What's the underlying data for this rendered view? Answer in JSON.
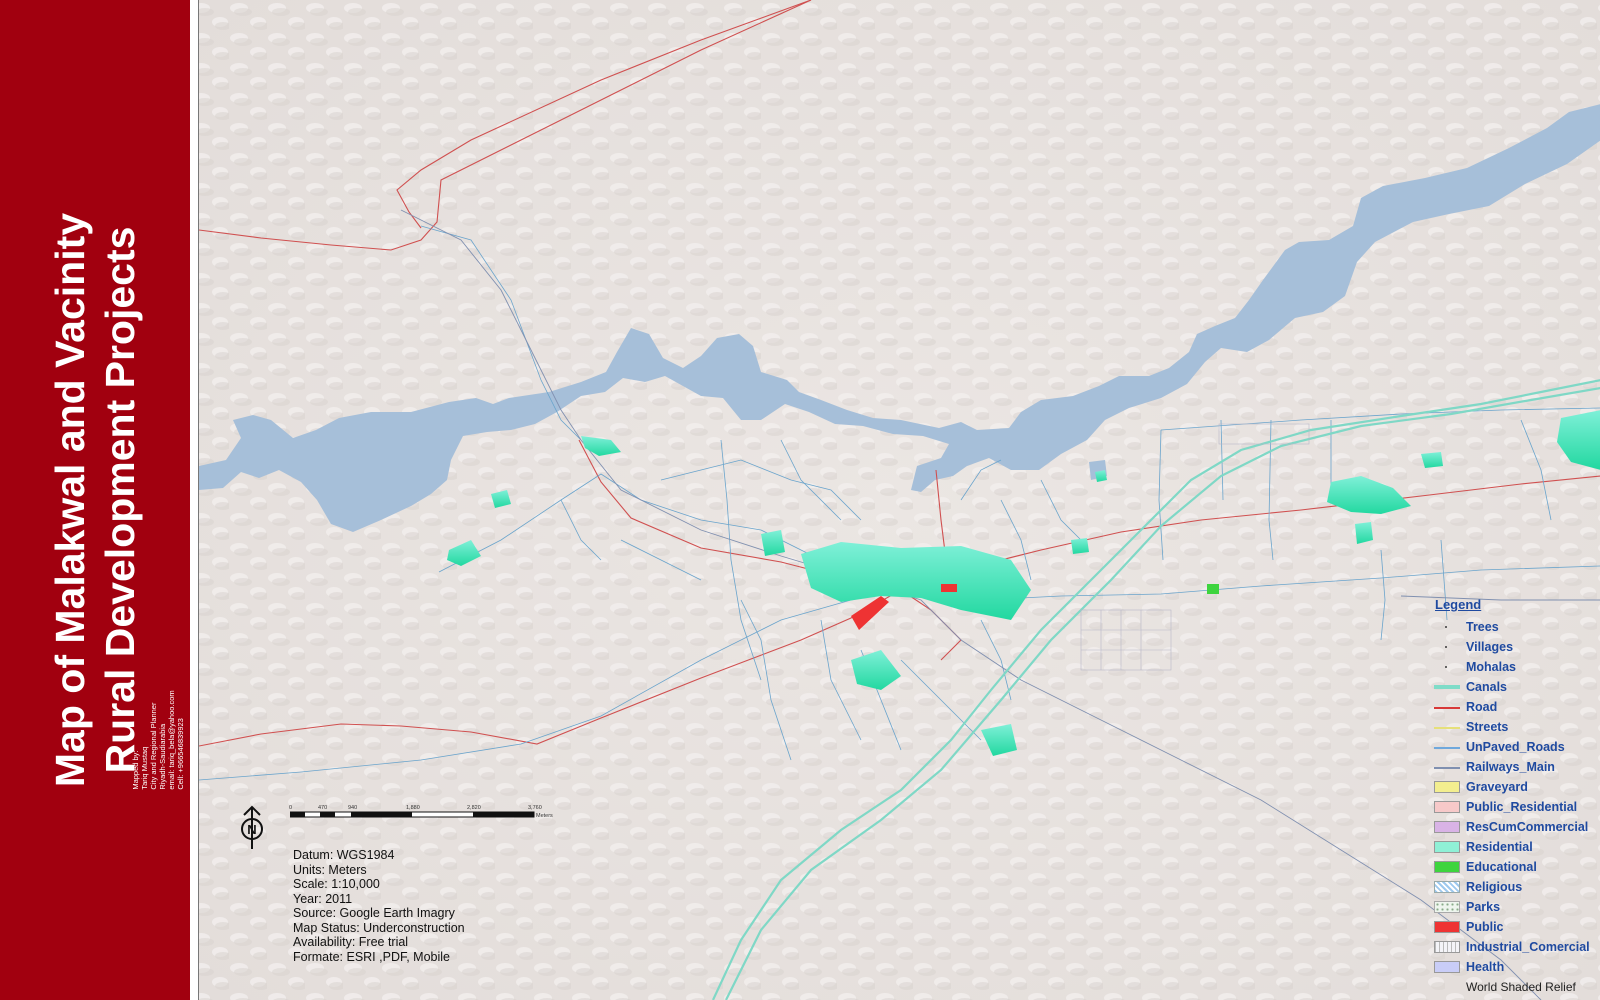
{
  "title": {
    "line1": "Map of Malakwal and Vacinity",
    "line2": "Rural Development Projects"
  },
  "mapper": [
    "Mapped by:",
    "Tariq Mustaq",
    "City and Regional Planner",
    "Riyadh-Saudiarabia",
    "email: tariq_bela@yahoo.com",
    "Cell: +966546839923"
  ],
  "legend": {
    "title": "Legend",
    "items": [
      {
        "label": "Trees",
        "icon": "dot",
        "color": "#3a3a3a"
      },
      {
        "label": "Villages",
        "icon": "dot",
        "color": "#3a3a3a"
      },
      {
        "label": "Mohalas",
        "icon": "dot",
        "color": "#3a3a3a"
      },
      {
        "label": "Canals",
        "icon": "thick-line",
        "color": "#7fdcc8"
      },
      {
        "label": "Road",
        "icon": "line",
        "color": "#d83838"
      },
      {
        "label": "Streets",
        "icon": "line",
        "color": "#e6e07a"
      },
      {
        "label": "UnPaved_Roads",
        "icon": "line",
        "color": "#6fa8dc"
      },
      {
        "label": "Railways_Main",
        "icon": "line",
        "color": "#8090b0"
      },
      {
        "label": "Graveyard",
        "icon": "fill",
        "color": "#f3ee8f"
      },
      {
        "label": "Public_Residential",
        "icon": "fill",
        "color": "#f7c9c9"
      },
      {
        "label": "ResCumCommercial",
        "icon": "fill",
        "color": "#d9b3e6"
      },
      {
        "label": "Residential",
        "icon": "fill",
        "color": "#8ff0d6"
      },
      {
        "label": "Educational",
        "icon": "fill",
        "color": "#3ed43e"
      },
      {
        "label": "Religious",
        "icon": "hatch",
        "color": "#9ec9ee"
      },
      {
        "label": "Parks",
        "icon": "dotted-fill",
        "color": "#c8e6c8"
      },
      {
        "label": "Public",
        "icon": "fill",
        "color": "#ee3333"
      },
      {
        "label": "Industrial_Comercial",
        "icon": "grid",
        "color": "#d8d8e8"
      },
      {
        "label": "Health",
        "icon": "fill",
        "color": "#c9cdf7"
      }
    ],
    "relief_label": "World Shaded Relief"
  },
  "scale": {
    "ticks": [
      "0",
      "470",
      "940",
      "1,880",
      "2,820",
      "3,760"
    ],
    "unit": "Meters"
  },
  "info": [
    "Datum: WGS1984",
    "Units: Meters",
    "Scale: 1:10,000",
    "Year: 2011",
    "Source: Google Earth Imagry",
    "Map Status: Underconstruction",
    "Availability: Free trial",
    "Formate: ESRI ,PDF, Mobile"
  ],
  "colors": {
    "panel": "#a1000f",
    "terrain": "#e9e4e1",
    "water": "#a6bfd9",
    "canal": "#7fd8c6",
    "road": "#d05050",
    "unpaved": "#6aa4cc",
    "residential": "#3ee8b8"
  }
}
